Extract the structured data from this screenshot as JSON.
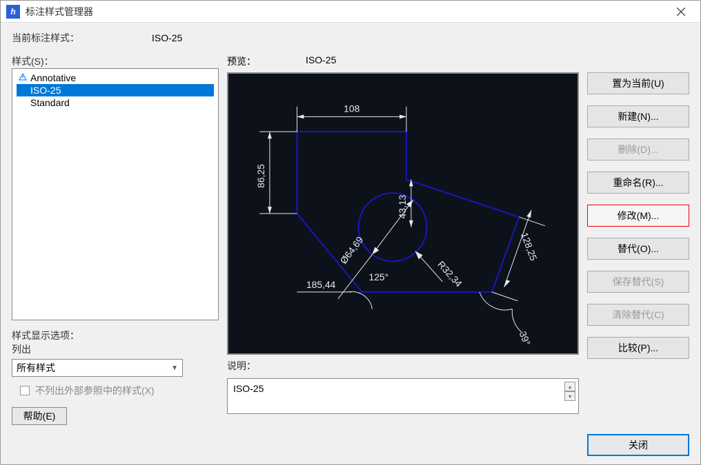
{
  "window": {
    "title": "标注样式管理器"
  },
  "current_style": {
    "label": "当前标注样式：",
    "value": "ISO-25"
  },
  "styles": {
    "label": "样式(S)：",
    "items": [
      {
        "name": "Annotative",
        "icon": "annotative",
        "selected": false
      },
      {
        "name": "ISO-25",
        "icon": null,
        "selected": true
      },
      {
        "name": "Standard",
        "icon": null,
        "selected": false
      }
    ]
  },
  "display_options": {
    "label": "样式显示选项：",
    "list_label": "列出",
    "combo_value": "所有样式",
    "checkbox_label": "不列出外部参照中的样式(X)",
    "checkbox_checked": false
  },
  "preview": {
    "label": "预览：",
    "value": "ISO-25",
    "dimensions": {
      "top_linear": "108",
      "left_vertical": "86,25",
      "bottom_linear": "185,44",
      "right_aligned": "128,25",
      "diameter": "Ø64,69",
      "radius": "R32,34",
      "central_vertical": "43,13",
      "angle_left": "125°",
      "angle_right": "39°"
    }
  },
  "description": {
    "label": "说明：",
    "value": "ISO-25"
  },
  "buttons": {
    "set_current": "置为当前(U)",
    "new": "新建(N)...",
    "delete": "删除(D)...",
    "rename": "重命名(R)...",
    "modify": "修改(M)...",
    "override": "替代(O)...",
    "save_override": "保存替代(S)",
    "clear_override": "清除替代(C)",
    "compare": "比较(P)...",
    "help": "帮助(E)",
    "close": "关闭"
  }
}
